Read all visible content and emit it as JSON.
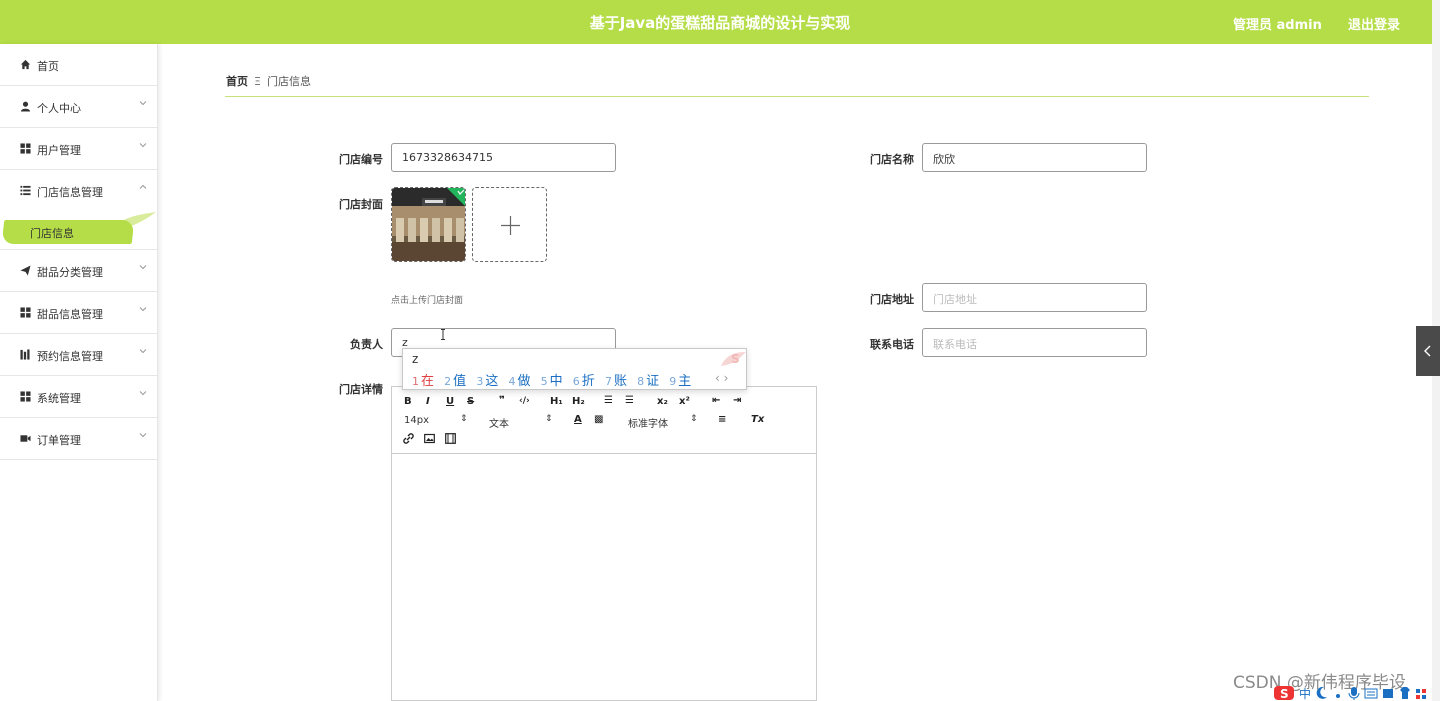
{
  "header": {
    "title": "基于Java的蛋糕甜品商城的设计与实现",
    "admin_label": "管理员 admin",
    "logout_label": "退出登录"
  },
  "sidebar": {
    "items": [
      {
        "label": "首页",
        "icon": "home-icon"
      },
      {
        "label": "个人中心",
        "icon": "user-icon"
      },
      {
        "label": "用户管理",
        "icon": "grid-icon"
      },
      {
        "label": "门店信息管理",
        "icon": "list-icon"
      },
      {
        "label": "甜品分类管理",
        "icon": "paper-plane-icon"
      },
      {
        "label": "甜品信息管理",
        "icon": "grid-icon"
      },
      {
        "label": "预约信息管理",
        "icon": "bar-chart-icon"
      },
      {
        "label": "系统管理",
        "icon": "grid-icon"
      },
      {
        "label": "订单管理",
        "icon": "video-icon"
      }
    ],
    "active_sub": "门店信息"
  },
  "breadcrumb": {
    "home": "首页",
    "separator": "Ξ",
    "current": "门店信息"
  },
  "form": {
    "store_no_label": "门店编号",
    "store_no_value": "1673328634715",
    "store_name_label": "门店名称",
    "store_name_value": "欣欣",
    "cover_label": "门店封面",
    "cover_hint": "点击上传门店封面",
    "address_label": "门店地址",
    "address_placeholder": "门店地址",
    "manager_label": "负责人",
    "manager_value": "z",
    "phone_label": "联系电话",
    "phone_placeholder": "联系电话",
    "detail_label": "门店详情"
  },
  "editor": {
    "font_size": "14px",
    "text_type": "文本",
    "font_family": "标准字体",
    "h1": "H₁",
    "h2": "H₂",
    "sub": "x₂",
    "sup": "x²"
  },
  "ime": {
    "composition": "z",
    "candidates": [
      {
        "n": "1",
        "ch": "在"
      },
      {
        "n": "2",
        "ch": "值"
      },
      {
        "n": "3",
        "ch": "这"
      },
      {
        "n": "4",
        "ch": "做"
      },
      {
        "n": "5",
        "ch": "中"
      },
      {
        "n": "6",
        "ch": "折"
      },
      {
        "n": "7",
        "ch": "账"
      },
      {
        "n": "8",
        "ch": "证"
      },
      {
        "n": "9",
        "ch": "主"
      }
    ],
    "nav": "‹ ›"
  },
  "watermark": "CSDN @新伟程序毕设",
  "colors": {
    "brand": "#b5dd47",
    "text": "#333333"
  }
}
